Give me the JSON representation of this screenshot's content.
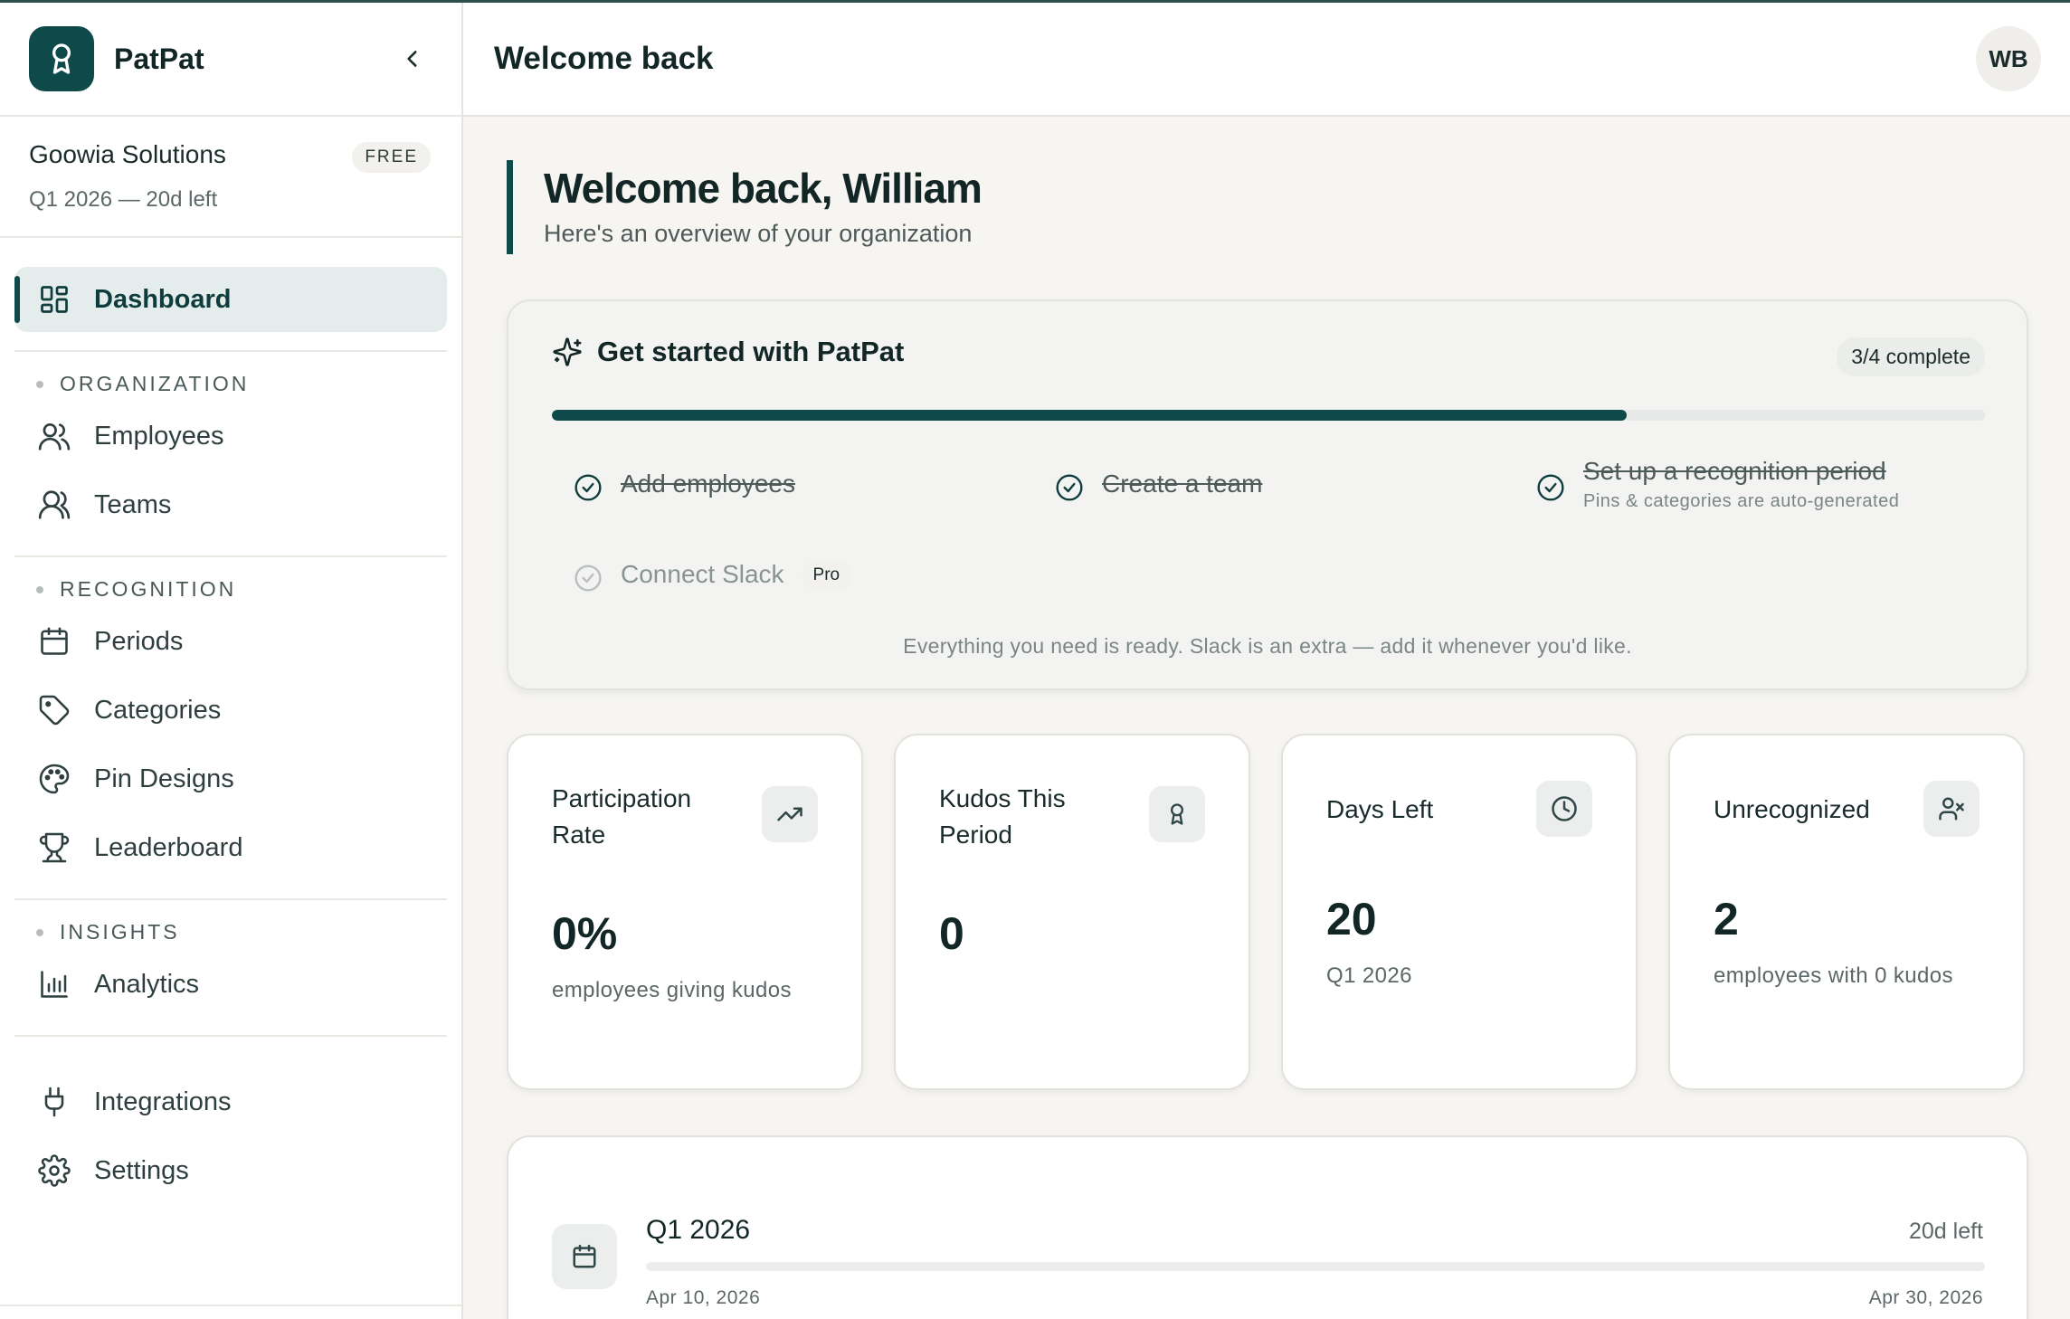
{
  "brand": {
    "name": "PatPat"
  },
  "org": {
    "name": "Goowia Solutions",
    "plan": "FREE",
    "period": "Q1 2026 — 20d left"
  },
  "nav": {
    "dashboard": "Dashboard",
    "sections": {
      "organization": "ORGANIZATION",
      "recognition": "RECOGNITION",
      "insights": "INSIGHTS"
    },
    "employees": "Employees",
    "teams": "Teams",
    "periods": "Periods",
    "categories": "Categories",
    "pin_designs": "Pin Designs",
    "leaderboard": "Leaderboard",
    "analytics": "Analytics",
    "integrations": "Integrations",
    "settings": "Settings"
  },
  "header": {
    "title": "Welcome back",
    "avatar_initials": "WB"
  },
  "welcome": {
    "title": "Welcome back, William",
    "subtitle": "Here's an overview of your organization"
  },
  "onboarding": {
    "title": "Get started with PatPat",
    "status": "3/4 complete",
    "progress": 0.75,
    "steps": [
      {
        "label": "Add employees",
        "done": true
      },
      {
        "label": "Create a team",
        "done": true
      },
      {
        "label": "Set up a recognition period",
        "sub": "Pins & categories are auto-generated",
        "done": true
      },
      {
        "label": "Connect Slack",
        "badge": "Pro",
        "done": false
      }
    ],
    "note": "Everything you need is ready. Slack is an extra — add it whenever you'd like."
  },
  "stats": [
    {
      "label": "Participation Rate",
      "value": "0%",
      "sub": "employees giving kudos",
      "icon": "trending-up-icon"
    },
    {
      "label": "Kudos This Period",
      "value": "0",
      "sub": "",
      "icon": "award-icon"
    },
    {
      "label": "Days Left",
      "value": "20",
      "sub": "Q1 2026",
      "icon": "clock-icon"
    },
    {
      "label": "Unrecognized",
      "value": "2",
      "sub": "employees with 0 kudos",
      "icon": "user-x-icon"
    }
  ],
  "period": {
    "name": "Q1 2026",
    "days_left": "20d left",
    "start": "Apr 10, 2026",
    "end": "Apr 30, 2026",
    "progress": 0.0
  },
  "colors": {
    "accent": "#0f4a4a",
    "background": "#f6f5f2"
  }
}
